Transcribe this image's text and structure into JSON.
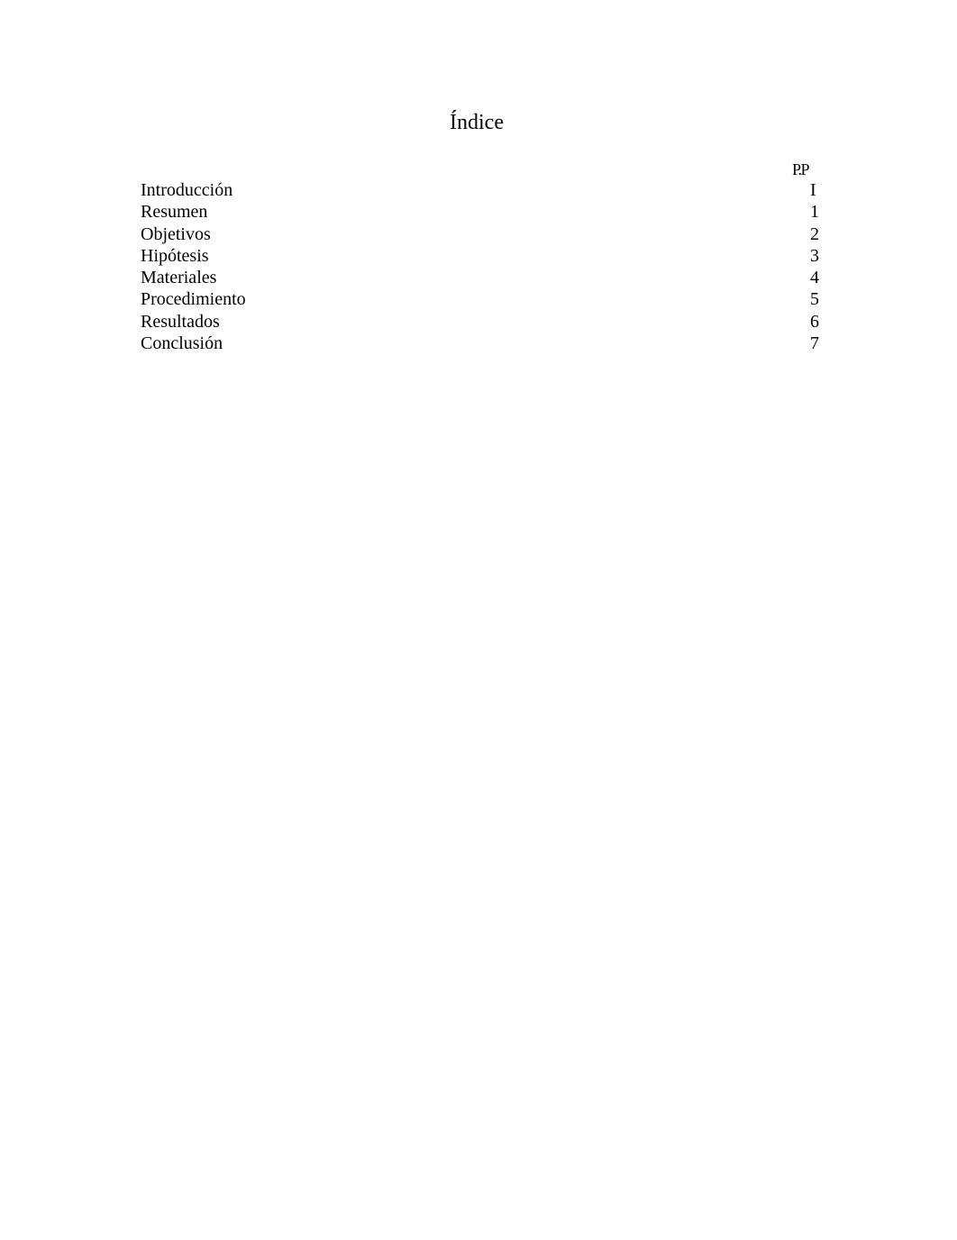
{
  "document": {
    "title": "Índice",
    "page_column_header": "P.P",
    "entries": [
      {
        "label": "Introducción",
        "page": "I"
      },
      {
        "label": "Resumen",
        "page": "1"
      },
      {
        "label": "Objetivos",
        "page": "2"
      },
      {
        "label": "Hipótesis",
        "page": "3"
      },
      {
        "label": "Materiales",
        "page": "4"
      },
      {
        "label": "Procedimiento",
        "page": "5"
      },
      {
        "label": "Resultados",
        "page": "6"
      },
      {
        "label": "Conclusión",
        "page": "7"
      }
    ]
  }
}
